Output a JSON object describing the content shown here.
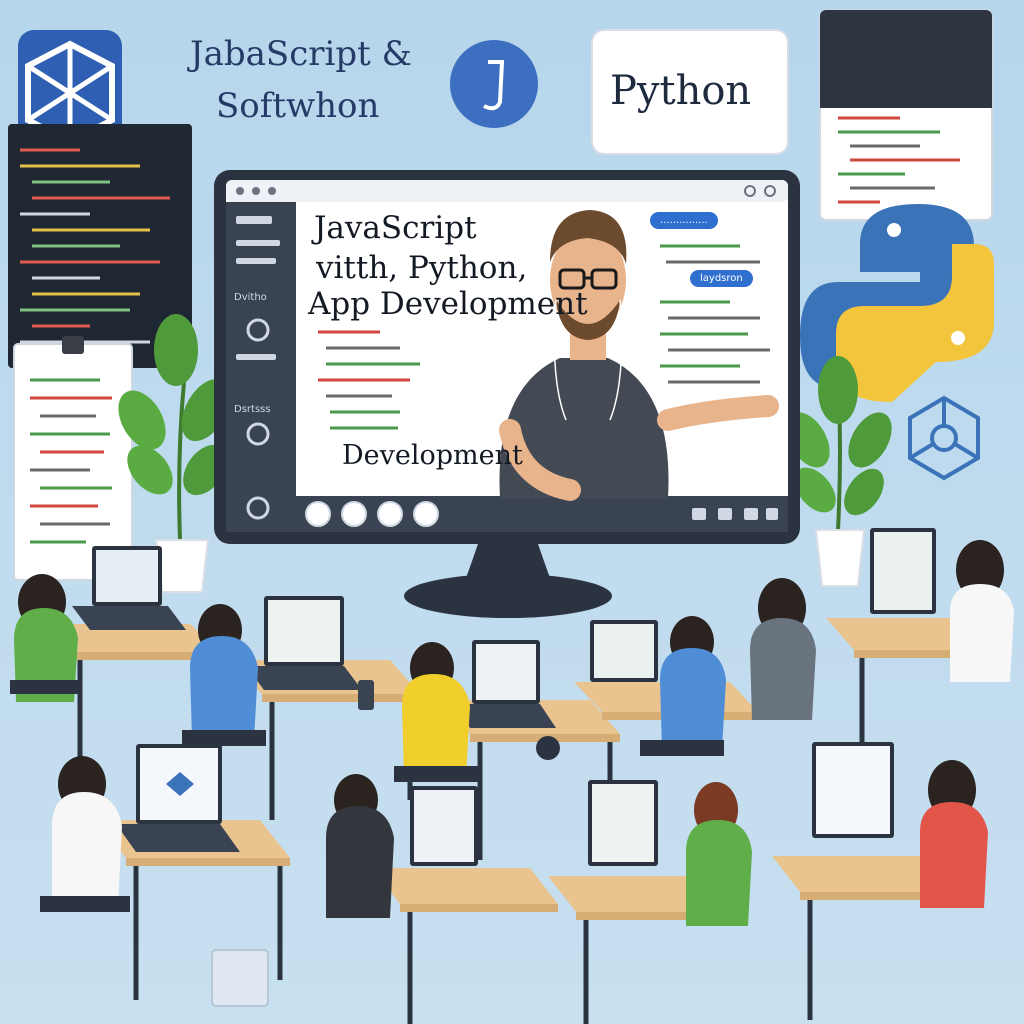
{
  "header": {
    "title_line_1": "JabaScript &",
    "title_line_2": "Softwhon"
  },
  "python_label": "Python",
  "presentation": {
    "line_1": "JavaScript",
    "line_2": "vitth, Python,",
    "line_3": "App Development",
    "line_4": "Development",
    "chip_1": "...............",
    "chip_2": "laydsron"
  },
  "sidebar_labels": [
    "Dvitho",
    "Dsrtsss"
  ],
  "icons": [
    "logo-icon",
    "js-badge-icon",
    "python-icon",
    "network-icon"
  ],
  "colors": {
    "background": "#bcd9ec",
    "monitor_frame": "#2b3340",
    "python_blue": "#3b73b9",
    "python_yellow": "#f2c53d",
    "desk": "#e9c48f",
    "accent_blue": "#2f6fd0"
  }
}
